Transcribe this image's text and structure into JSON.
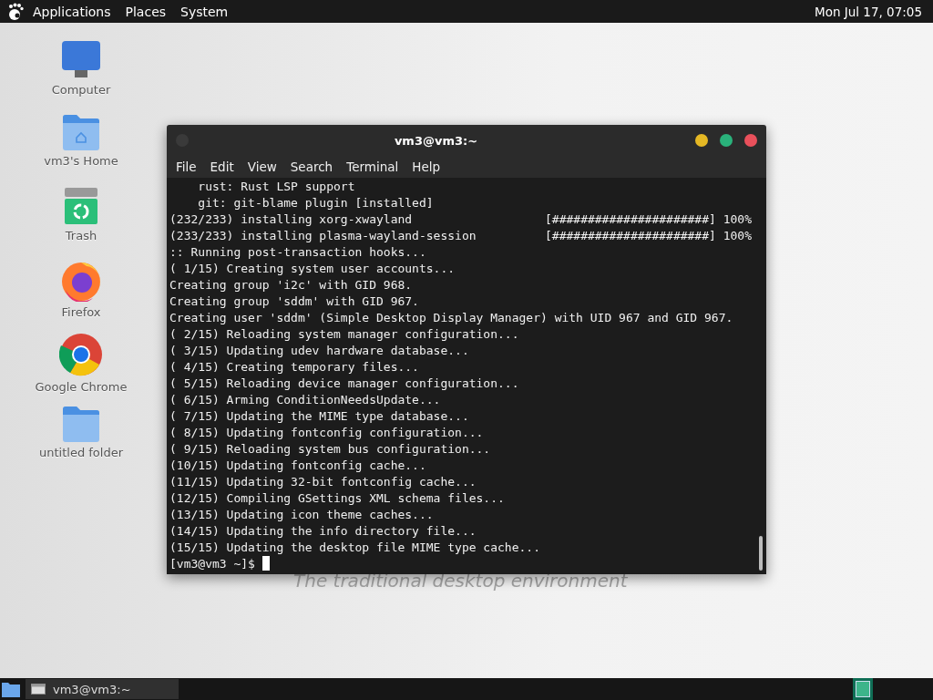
{
  "top_panel": {
    "menus": [
      "Applications",
      "Places",
      "System"
    ],
    "clock": "Mon Jul 17, 07:05"
  },
  "desktop_icons": [
    {
      "kind": "computer",
      "label": "Computer"
    },
    {
      "kind": "home",
      "label": "vm3's Home"
    },
    {
      "kind": "trash",
      "label": "Trash"
    },
    {
      "kind": "firefox",
      "label": "Firefox"
    },
    {
      "kind": "chrome",
      "label": "Google Chrome"
    },
    {
      "kind": "folder",
      "label": "untitled folder"
    }
  ],
  "wallpaper_tagline": "The traditional desktop environment",
  "terminal": {
    "title": "vm3@vm3:~",
    "menu": [
      "File",
      "Edit",
      "View",
      "Search",
      "Terminal",
      "Help"
    ],
    "lines": [
      {
        "text": "    rust: Rust LSP support"
      },
      {
        "text": "    git: git-blame plugin [installed]"
      },
      {
        "text": "(232/233) installing xorg-xwayland",
        "progress": "[######################] 100%"
      },
      {
        "text": "(233/233) installing plasma-wayland-session",
        "progress": "[######################] 100%"
      },
      {
        "text": ":: Running post-transaction hooks..."
      },
      {
        "text": "( 1/15) Creating system user accounts..."
      },
      {
        "text": "Creating group 'i2c' with GID 968."
      },
      {
        "text": "Creating group 'sddm' with GID 967."
      },
      {
        "text": "Creating user 'sddm' (Simple Desktop Display Manager) with UID 967 and GID 967."
      },
      {
        "text": "( 2/15) Reloading system manager configuration..."
      },
      {
        "text": "( 3/15) Updating udev hardware database..."
      },
      {
        "text": "( 4/15) Creating temporary files..."
      },
      {
        "text": "( 5/15) Reloading device manager configuration..."
      },
      {
        "text": "( 6/15) Arming ConditionNeedsUpdate..."
      },
      {
        "text": "( 7/15) Updating the MIME type database..."
      },
      {
        "text": "( 8/15) Updating fontconfig configuration..."
      },
      {
        "text": "( 9/15) Reloading system bus configuration..."
      },
      {
        "text": "(10/15) Updating fontconfig cache..."
      },
      {
        "text": "(11/15) Updating 32-bit fontconfig cache..."
      },
      {
        "text": "(12/15) Compiling GSettings XML schema files..."
      },
      {
        "text": "(13/15) Updating icon theme caches..."
      },
      {
        "text": "(14/15) Updating the info directory file..."
      },
      {
        "text": "(15/15) Updating the desktop file MIME type cache..."
      }
    ],
    "prompt": "[vm3@vm3 ~]$"
  },
  "taskbar": {
    "tasks": [
      {
        "label": "vm3@vm3:~",
        "selected": true
      }
    ],
    "workspaces": [
      {
        "selected": true
      }
    ]
  }
}
